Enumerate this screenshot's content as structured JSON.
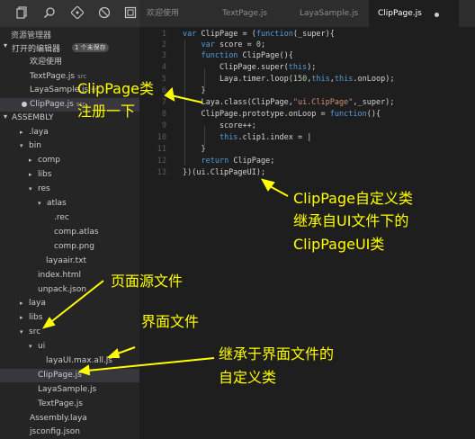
{
  "tabs": [
    {
      "label": "欢迎使用"
    },
    {
      "label": "TextPage.js"
    },
    {
      "label": "LayaSample.js"
    },
    {
      "label": "ClipPage.js"
    }
  ],
  "sidebar": {
    "title": "资源管理器",
    "open_editors": {
      "label": "打开的编辑器",
      "badge": "1 个未保存"
    },
    "open_files": [
      {
        "label": "欢迎使用",
        "tag": ""
      },
      {
        "label": "TextPage.js",
        "tag": "src"
      },
      {
        "label": "LayaSample.js",
        "tag": "src"
      },
      {
        "label": "ClipPage.js",
        "tag": "src"
      }
    ],
    "project": {
      "label": "ASSEMBLY"
    },
    "tree": [
      {
        "label": ".laya"
      },
      {
        "label": "bin"
      },
      {
        "label": "comp"
      },
      {
        "label": "libs"
      },
      {
        "label": "res"
      },
      {
        "label": "atlas"
      },
      {
        "label": ".rec"
      },
      {
        "label": "comp.atlas"
      },
      {
        "label": "comp.png"
      },
      {
        "label": "layaair.txt"
      },
      {
        "label": "index.html"
      },
      {
        "label": "unpack.json"
      },
      {
        "label": "laya"
      },
      {
        "label": "libs"
      },
      {
        "label": "src"
      },
      {
        "label": "ui"
      },
      {
        "label": "layaUI.max.all.js"
      },
      {
        "label": "ClipPage.js"
      },
      {
        "label": "LayaSample.js"
      },
      {
        "label": "TextPage.js"
      },
      {
        "label": "Assembly.laya"
      },
      {
        "label": "jsconfig.json"
      }
    ]
  },
  "editor": {
    "line_numbers": [
      "1",
      "2",
      "3",
      "4",
      "5",
      "6",
      "7",
      "8",
      "9",
      "10",
      "11",
      "12",
      "13"
    ],
    "lines": [
      "var ClipPage = (function(_super){",
      "    var score = 0;",
      "    function ClipPage(){",
      "        ClipPage.super(this);",
      "        Laya.timer.loop(150,this,this.onLoop);",
      "    }",
      "    Laya.class(ClipPage,\"ui.ClipPage\",_super);",
      "    ClipPage.prototype.onLoop = function(){",
      "        score++;",
      "        this.clip1.index = |",
      "    }",
      "    return ClipPage;",
      "})(ui.ClipPageUI);"
    ]
  },
  "annotations": {
    "register_line1": "ClipPage类",
    "register_line2": "注册一下",
    "custom_class_line1": "ClipPage自定义类",
    "custom_class_line2": "继承自UI文件下的",
    "custom_class_line3": "ClipPageUI类",
    "page_source": "页面源文件",
    "ui_file": "界面文件",
    "inherit_line1": "继承于界面文件的",
    "inherit_line2": "自定义类"
  },
  "colors": {
    "annotation": "#ffff00",
    "editor_bg": "#1e1e1e",
    "sidebar_bg": "#252526"
  }
}
